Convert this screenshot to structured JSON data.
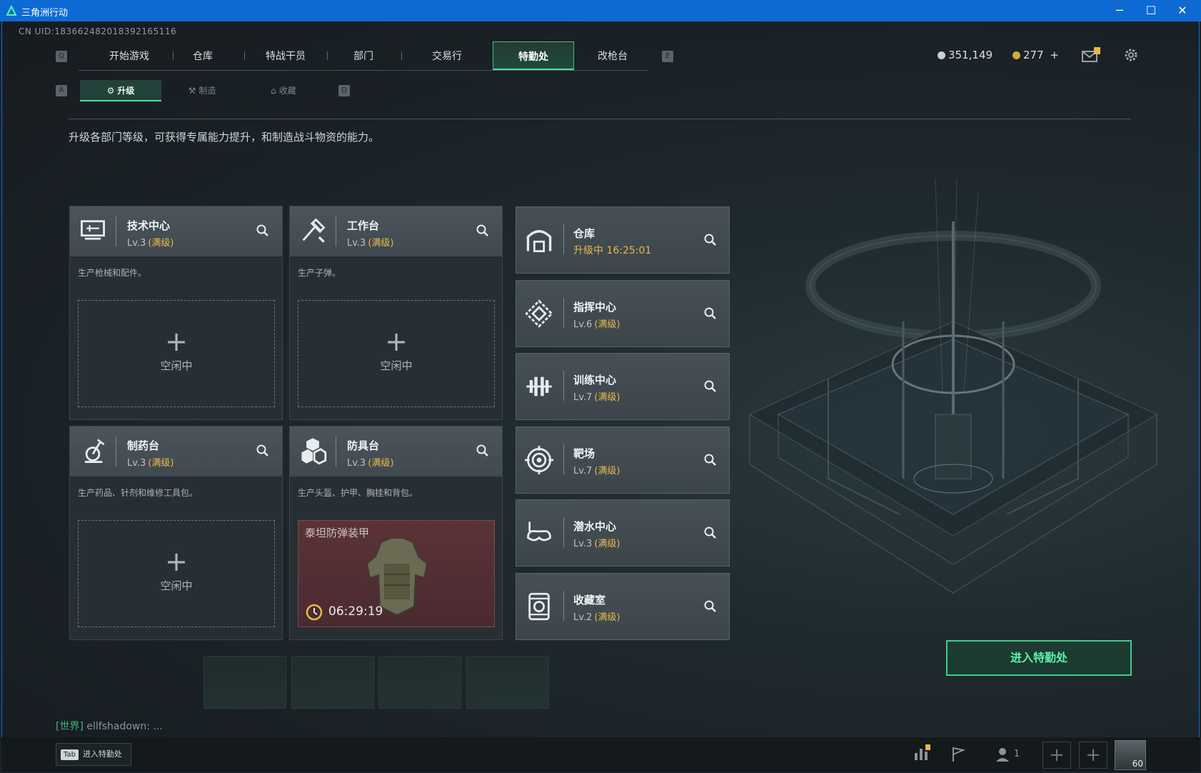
{
  "window": {
    "title": "三角洲行动",
    "minimize": "─",
    "maximize": "☐",
    "close": "✕"
  },
  "uid": "CN UID:183662482018392165116",
  "nav": {
    "key_left": "Q",
    "key_right": "E",
    "tabs": [
      "开始游戏",
      "仓库",
      "特战干员",
      "部门",
      "交易行",
      "特勤处",
      "改枪台"
    ],
    "active_index": 5
  },
  "currency": {
    "coins": "351,149",
    "tokens": "277",
    "plus": "+"
  },
  "subnav": {
    "key_left": "A",
    "key_right": "D",
    "tabs": [
      "升级",
      "制造",
      "收藏"
    ],
    "active_index": 0
  },
  "description": "升级各部门等级，可获得专属能力提升，和制造战斗物资的能力。",
  "production_cards": [
    {
      "name": "技术中心",
      "level": "Lv.3",
      "max": "(满级)",
      "desc": "生产枪械和配件。",
      "slot_state": "空闲中"
    },
    {
      "name": "工作台",
      "level": "Lv.3",
      "max": "(满级)",
      "desc": "生产子弹。",
      "slot_state": "空闲中"
    },
    {
      "name": "制药台",
      "level": "Lv.3",
      "max": "(满级)",
      "desc": "生产药品、针剂和维修工具包。",
      "slot_state": "空闲中"
    },
    {
      "name": "防具台",
      "level": "Lv.3",
      "max": "(满级)",
      "desc": "生产头盔、护甲、胸挂和背包。",
      "item_name": "泰坦防弹装甲",
      "item_timer": "06:29:19"
    }
  ],
  "facility_cards": [
    {
      "name": "仓库",
      "status": "升级中 16:25:01"
    },
    {
      "name": "指挥中心",
      "level": "Lv.6",
      "max": "(满级)"
    },
    {
      "name": "训练中心",
      "level": "Lv.7",
      "max": "(满级)"
    },
    {
      "name": "靶场",
      "level": "Lv.7",
      "max": "(满级)"
    },
    {
      "name": "潜水中心",
      "level": "Lv.3",
      "max": "(满级)"
    },
    {
      "name": "收藏室",
      "level": "Lv.2",
      "max": "(满级)"
    }
  ],
  "enter_button": "进入特勤处",
  "chat": {
    "channel": "[世界]",
    "message": "ellfshadown: ..."
  },
  "bottom": {
    "tab_key": "Tab",
    "tab_label": "进入特勤处",
    "friends_count": "1",
    "level": "60"
  },
  "colors": {
    "accent": "#4ee0a0",
    "max_level": "#e8b84a",
    "titlebar": "#0e6ad3"
  }
}
